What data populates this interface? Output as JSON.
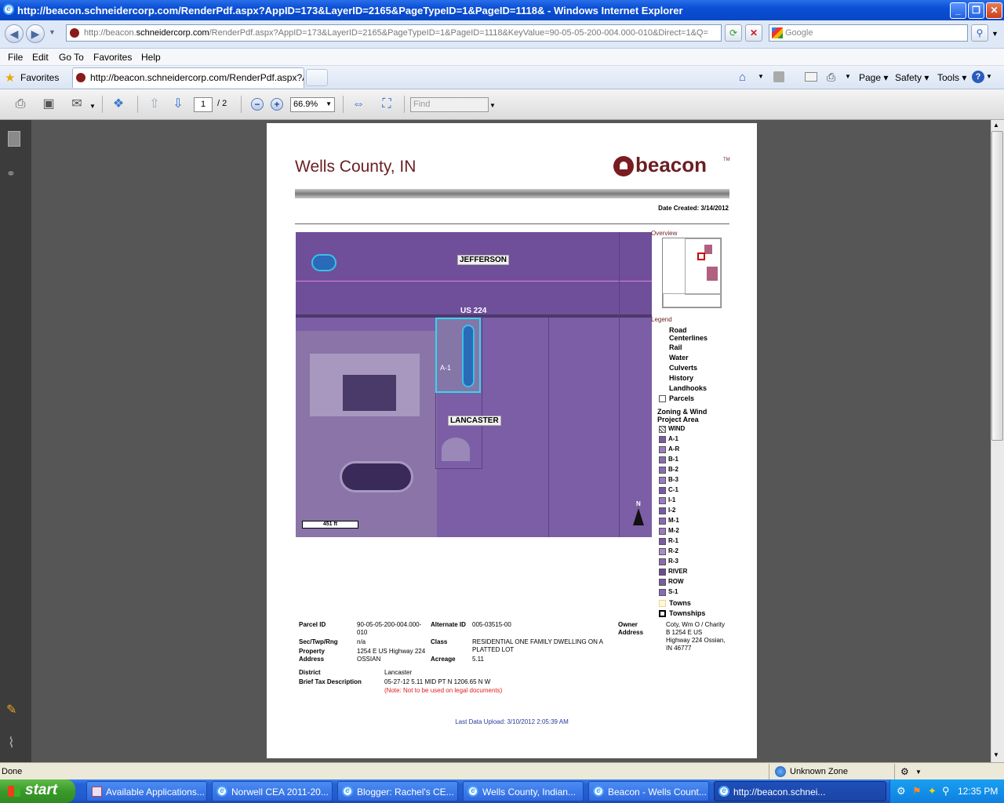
{
  "window": {
    "title": "http://beacon.schneidercorp.com/RenderPdf.aspx?AppID=173&LayerID=2165&PageTypeID=1&PageID=1118& - Windows Internet Explorer"
  },
  "address": {
    "url_prefix": "http://beacon.",
    "url_domain": "schneidercorp.com",
    "url_rest": "/RenderPdf.aspx?AppID=173&LayerID=2165&PageTypeID=1&PageID=1118&KeyValue=90-05-05-200-004.000-010&Direct=1&Q=",
    "search_placeholder": "Google"
  },
  "menu": {
    "file": "File",
    "edit": "Edit",
    "goto": "Go To",
    "favorites": "Favorites",
    "help": "Help"
  },
  "favbar": {
    "favorites_label": "Favorites",
    "tab_title": "http://beacon.schneidercorp.com/RenderPdf.aspx?A...",
    "page_label": "Page",
    "safety_label": "Safety",
    "tools_label": "Tools"
  },
  "pdf_toolbar": {
    "page_current": "1",
    "page_total": "/ 2",
    "zoom": "66.9%",
    "find_placeholder": "Find"
  },
  "report": {
    "county_title": "Wells County, IN",
    "logo_text": "beacon",
    "logo_tm": "TM",
    "date_created": "Date Created: 3/14/2012",
    "map": {
      "label_jefferson": "JEFFERSON",
      "label_us224": "US 224",
      "label_lancaster": "LANCASTER",
      "label_parcel": "A-1",
      "scale": "451 ft",
      "north": "N"
    },
    "overview_label": "Overview",
    "legend_label": "Legend",
    "legend_items": [
      "Road Centerlines",
      "Rail",
      "Water",
      "Culverts",
      "History",
      "Landhooks",
      "Parcels"
    ],
    "zoning_title": "Zoning & Wind Project Area",
    "zoning_items": [
      "WIND",
      "A-1",
      "A-R",
      "B-1",
      "B-2",
      "B-3",
      "C-1",
      "I-1",
      "I-2",
      "M-1",
      "M-2",
      "R-1",
      "R-2",
      "R-3",
      "RIVER",
      "ROW",
      "S-1"
    ],
    "towns_label": "Towns",
    "townships_label": "Townships",
    "info": {
      "parcel_id_label": "Parcel ID",
      "parcel_id_value": "90-05-05-200-004.000-010",
      "alt_id_label": "Alternate ID",
      "alt_id_value": "005-03515-00",
      "owner_label": "Owner Address",
      "owner_value": "Coty, Wm O / Charity B 1254 E US Highway 224 Ossian, IN 46777",
      "sec_label": "Sec/Twp/Rng",
      "sec_value": "n/a",
      "class_label": "Class",
      "class_value": "RESIDENTIAL ONE FAMILY DWELLING ON A PLATTED LOT",
      "prop_label": "Property Address",
      "prop_value": "1254 E US Highway 224 OSSIAN",
      "acreage_label": "Acreage",
      "acreage_value": "5.11",
      "district_label": "District",
      "district_value": "Lancaster",
      "tax_label": "Brief Tax Description",
      "tax_value": "05-27-12 5.11 MID PT N 1206.65 N W",
      "tax_note": "(Note: Not to be used on legal documents)"
    },
    "last_upload": "Last Data Upload: 3/10/2012 2:05:39 AM"
  },
  "status": {
    "left": "Done",
    "zone": "Unknown Zone"
  },
  "taskbar": {
    "start": "start",
    "tasks": [
      "Available Applications...",
      "Norwell CEA 2011-20...",
      "Blogger: Rachel's CE...",
      "Wells County, Indian...",
      "Beacon - Wells Count...",
      "http://beacon.schnei..."
    ],
    "clock": "12:35 PM"
  },
  "colors": {
    "title_maroon": "#6b1e21",
    "map_purple": "#7c5ea6",
    "parcel_outline": "#33d6f0"
  }
}
